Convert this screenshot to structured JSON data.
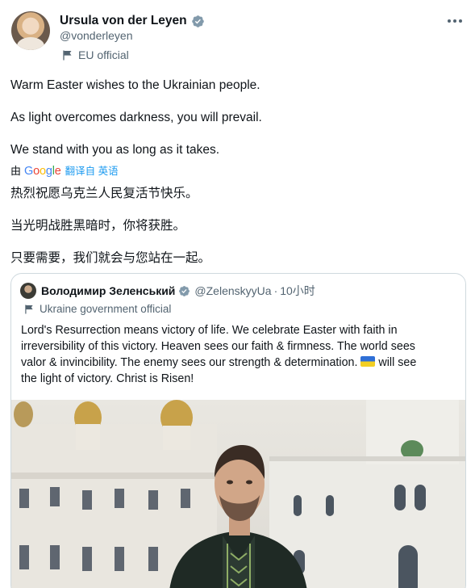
{
  "author": {
    "name": "Ursula von der Leyen",
    "handle": "@vonderleyen",
    "affiliation": "EU official"
  },
  "tweet": {
    "lines": [
      "Warm Easter wishes to the Ukrainian people.",
      "As light overcomes darkness, you will prevail.",
      "We stand with you as long as it takes."
    ]
  },
  "translation": {
    "by": "由",
    "google": [
      "G",
      "o",
      "o",
      "g",
      "l",
      "e"
    ],
    "link": "翻译自 英语",
    "lines": [
      "热烈祝愿乌克兰人民复活节快乐。",
      "当光明战胜黑暗时，你将获胜。",
      "只要需要，我们就会与您站在一起。"
    ]
  },
  "quote": {
    "name": "Володимир Зеленський",
    "handle": "@ZelenskyyUa",
    "separator": "·",
    "time": "10小时",
    "affiliation": "Ukraine government official",
    "text_lines": [
      "Lord's Resurrection means victory of life. We celebrate Easter with faith in",
      "irreversibility of this victory. Heaven sees our faith & firmness. The world sees",
      "valor & invincibility. The enemy sees our strength & determination."
    ],
    "text_after_flag": " will see",
    "text_last": "the light of victory. Christ is Risen!"
  },
  "colors": {
    "text": "#0f1419",
    "secondary": "#536471",
    "link": "#1d9bf0",
    "verified": "#829aab",
    "border": "#cfd9de",
    "google_blue": "#4285f4",
    "google_red": "#ea4335",
    "google_yellow": "#fbbc05",
    "google_green": "#34a853"
  },
  "icons": {
    "verified": "verified-badge-icon",
    "affiliation": "flag-icon",
    "more": "more-dots-icon",
    "ukraine_flag": "ukraine-flag-emoji"
  }
}
